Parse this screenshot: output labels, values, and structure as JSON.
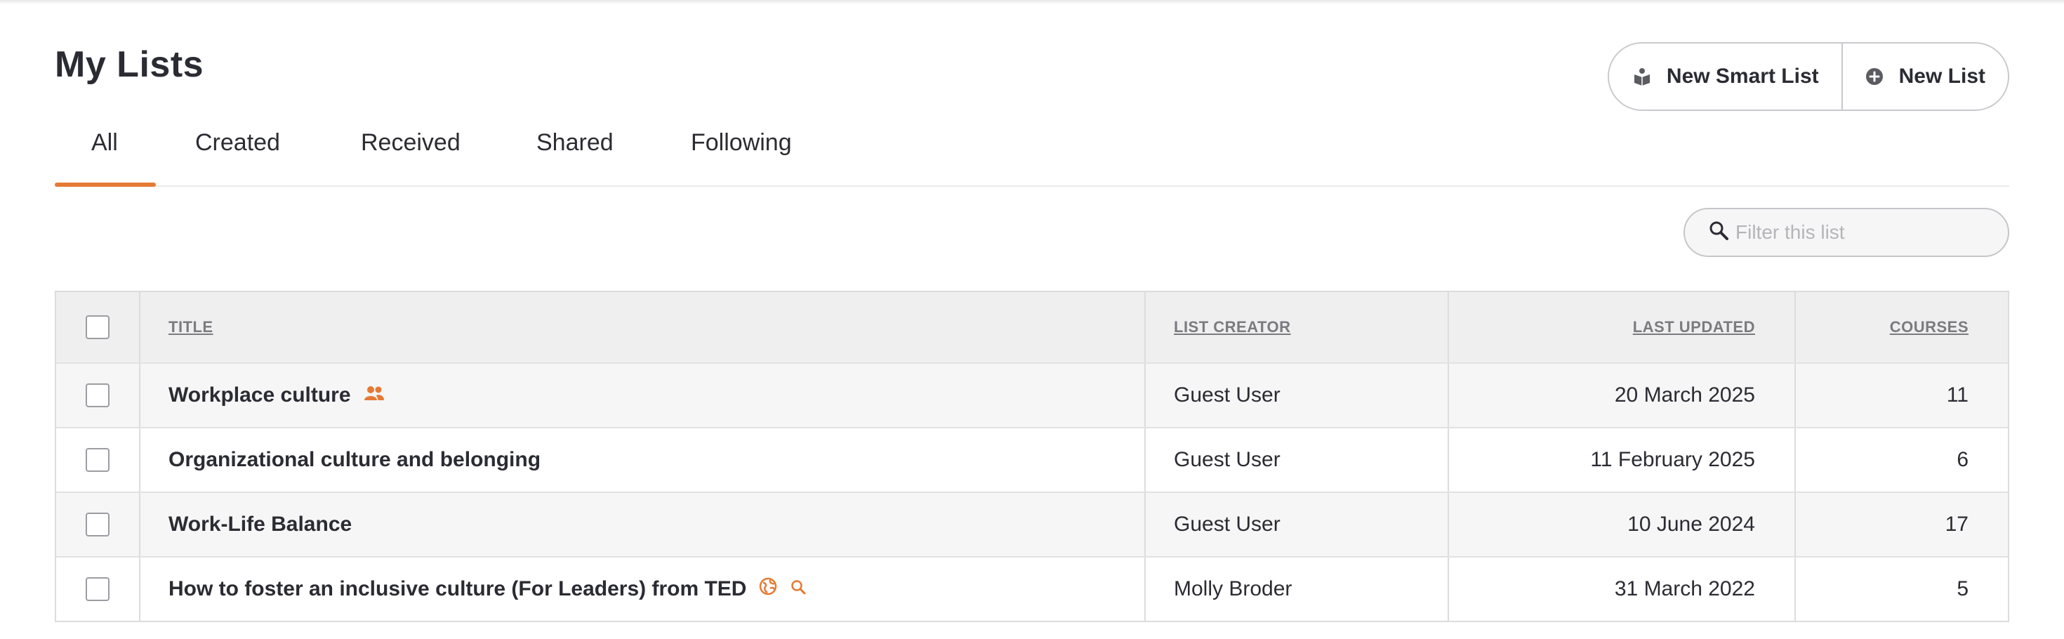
{
  "page": {
    "title": "My Lists"
  },
  "actions": {
    "new_smart_list": "New Smart List",
    "new_list": "New List"
  },
  "tabs": [
    {
      "label": "All",
      "active": true
    },
    {
      "label": "Created",
      "active": false
    },
    {
      "label": "Received",
      "active": false
    },
    {
      "label": "Shared",
      "active": false
    },
    {
      "label": "Following",
      "active": false
    }
  ],
  "filter": {
    "placeholder": "Filter this list",
    "value": ""
  },
  "table": {
    "headers": {
      "title": "TITLE",
      "creator": "LIST CREATOR",
      "updated": "LAST UPDATED",
      "courses": "COURSES"
    },
    "rows": [
      {
        "title": "Workplace culture",
        "icons": [
          "shared-users-icon"
        ],
        "creator": "Guest User",
        "updated": "20 March 2025",
        "courses": "11"
      },
      {
        "title": "Organizational culture and belonging",
        "icons": [],
        "creator": "Guest User",
        "updated": "11 February 2025",
        "courses": "6"
      },
      {
        "title": "Work-Life Balance",
        "icons": [],
        "creator": "Guest User",
        "updated": "10 June 2024",
        "courses": "17"
      },
      {
        "title": "How to foster an inclusive culture (For Leaders) from TED",
        "icons": [
          "globe-icon",
          "search-icon"
        ],
        "creator": "Molly Broder",
        "updated": "31 March 2022",
        "courses": "5"
      }
    ]
  },
  "colors": {
    "accent": "#e57a35",
    "text": "#2b2b33",
    "header_bg": "#efefef"
  }
}
